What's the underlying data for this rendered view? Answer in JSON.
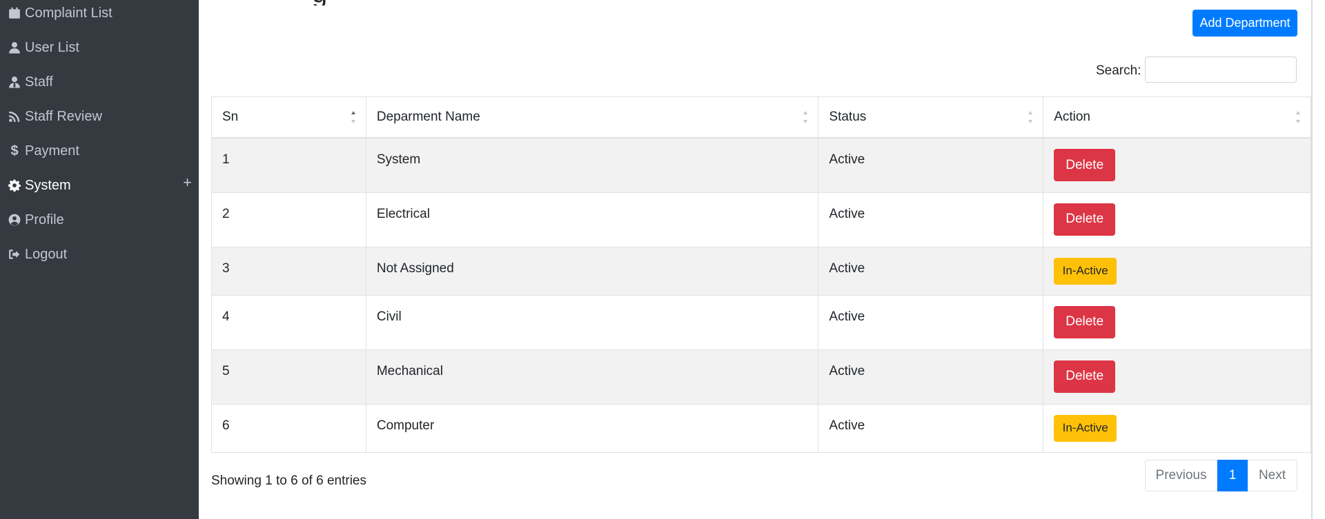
{
  "sidebar": {
    "items": [
      {
        "label": "Complaint List",
        "icon": "calendar-icon"
      },
      {
        "label": "User List",
        "icon": "user-icon"
      },
      {
        "label": "Staff",
        "icon": "user-tie-icon"
      },
      {
        "label": "Staff Review",
        "icon": "rss-icon"
      },
      {
        "label": "Payment",
        "icon": "dollar-icon"
      },
      {
        "label": "System",
        "icon": "gear-icon",
        "active": true,
        "expand": "+"
      },
      {
        "label": "Profile",
        "icon": "user-circle-icon"
      },
      {
        "label": "Logout",
        "icon": "sign-out-icon"
      }
    ]
  },
  "page": {
    "title_fragment": "g"
  },
  "toolbar": {
    "add_label": "Add Department"
  },
  "search": {
    "label": "Search:",
    "value": ""
  },
  "table": {
    "columns": [
      "Sn",
      "Deparment Name",
      "Status",
      "Action"
    ],
    "rows": [
      {
        "sn": "1",
        "name": "System",
        "status": "Active",
        "action": "Delete"
      },
      {
        "sn": "2",
        "name": "Electrical",
        "status": "Active",
        "action": "Delete"
      },
      {
        "sn": "3",
        "name": "Not Assigned",
        "status": "Active",
        "action": "In-Active"
      },
      {
        "sn": "4",
        "name": "Civil",
        "status": "Active",
        "action": "Delete"
      },
      {
        "sn": "5",
        "name": "Mechanical",
        "status": "Active",
        "action": "Delete"
      },
      {
        "sn": "6",
        "name": "Computer",
        "status": "Active",
        "action": "In-Active"
      }
    ]
  },
  "footer": {
    "info": "Showing 1 to 6 of 6 entries",
    "pagination": {
      "previous": "Previous",
      "current": "1",
      "next": "Next"
    }
  },
  "colors": {
    "sidebar_bg": "#343a40",
    "primary": "#007bff",
    "danger": "#dc3545",
    "warning": "#ffc107"
  }
}
